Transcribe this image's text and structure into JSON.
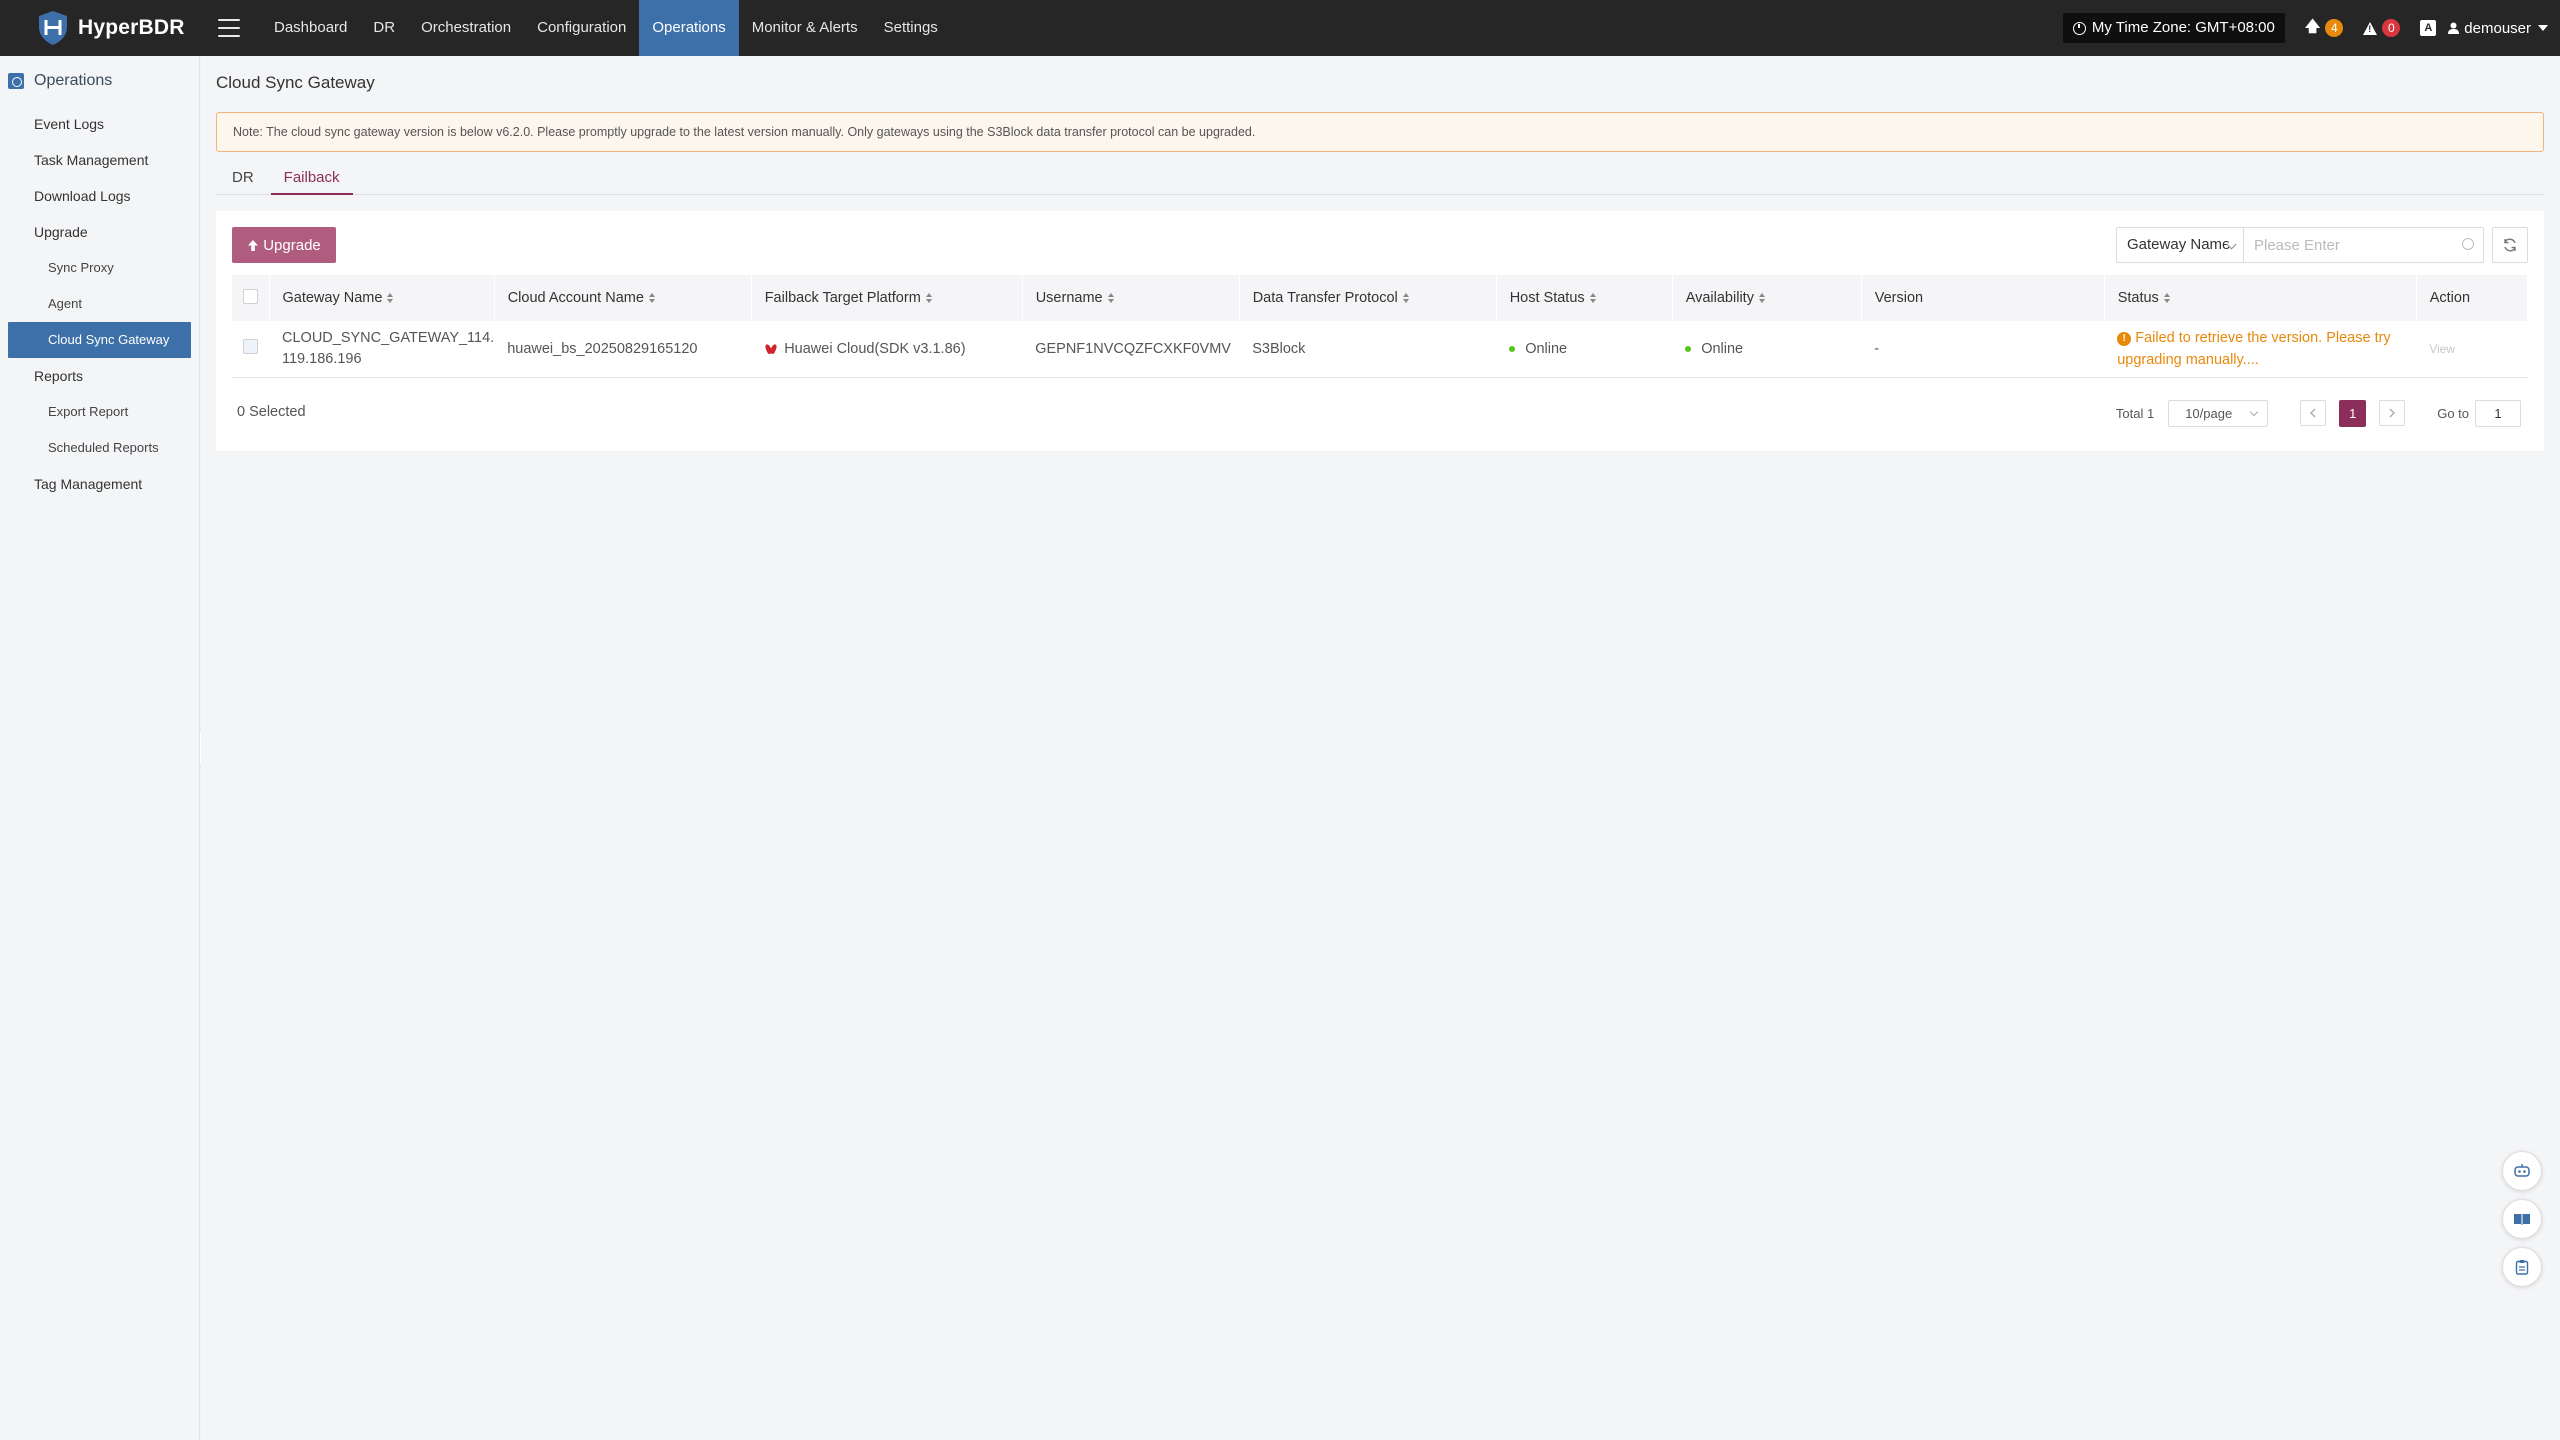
{
  "brand": {
    "name": "HyperBDR"
  },
  "nav": {
    "items": [
      {
        "label": "Dashboard",
        "active": false
      },
      {
        "label": "DR",
        "active": false
      },
      {
        "label": "Orchestration",
        "active": false
      },
      {
        "label": "Configuration",
        "active": false
      },
      {
        "label": "Operations",
        "active": true
      },
      {
        "label": "Monitor & Alerts",
        "active": false
      },
      {
        "label": "Settings",
        "active": false
      }
    ]
  },
  "topbar": {
    "timezone": "My Time Zone: GMT+08:00",
    "upgrade_count": "4",
    "alert_count": "0",
    "user": "demouser"
  },
  "sidebar": {
    "section_title": "Operations",
    "items": {
      "event_logs": "Event Logs",
      "task_management": "Task Management",
      "download_logs": "Download Logs",
      "upgrade": "Upgrade",
      "sync_proxy": "Sync Proxy",
      "agent": "Agent",
      "cloud_sync_gateway": "Cloud Sync Gateway",
      "reports": "Reports",
      "export_report": "Export Report",
      "scheduled_reports": "Scheduled Reports",
      "tag_management": "Tag Management"
    }
  },
  "page": {
    "title": "Cloud Sync Gateway",
    "notice": "Note: The cloud sync gateway version is below v6.2.0. Please promptly upgrade to the latest version manually. Only gateways using the S3Block data transfer protocol can be upgraded.",
    "tabs": [
      {
        "label": "DR",
        "active": false
      },
      {
        "label": "Failback",
        "active": true
      }
    ]
  },
  "toolbar": {
    "upgrade_label": "Upgrade",
    "search_field": "Gateway Name",
    "search_placeholder": "Please Enter"
  },
  "table": {
    "columns": {
      "gateway_name": "Gateway Name",
      "cloud_account": "Cloud Account Name",
      "platform": "Failback Target Platform",
      "username": "Username",
      "protocol": "Data Transfer Protocol",
      "host_status": "Host Status",
      "availability": "Availability",
      "version": "Version",
      "status": "Status",
      "action": "Action"
    },
    "rows": [
      {
        "gateway_name_line1": "CLOUD_SYNC_GATEWAY_114.",
        "gateway_name_line2": "119.186.196",
        "cloud_account": "huawei_bs_20250829165120",
        "platform": "Huawei Cloud(SDK v3.1.86)",
        "username": "GEPNF1NVCQZFCXKF0VMV",
        "protocol": "S3Block",
        "host_status": "Online",
        "availability": "Online",
        "version": "-",
        "status_line1": "Failed to retrieve the version. Please try",
        "status_line2": "upgrading manually....",
        "action": "View"
      }
    ]
  },
  "footer": {
    "selected": "0 Selected",
    "total": "Total 1",
    "page_size": "10/page",
    "current_page": "1",
    "goto_label": "Go to",
    "goto_value": "1"
  },
  "colors": {
    "accent": "#8b2f5a",
    "nav_active": "#3d6fa8",
    "warning": "#e8890b",
    "online": "#52c41a"
  }
}
